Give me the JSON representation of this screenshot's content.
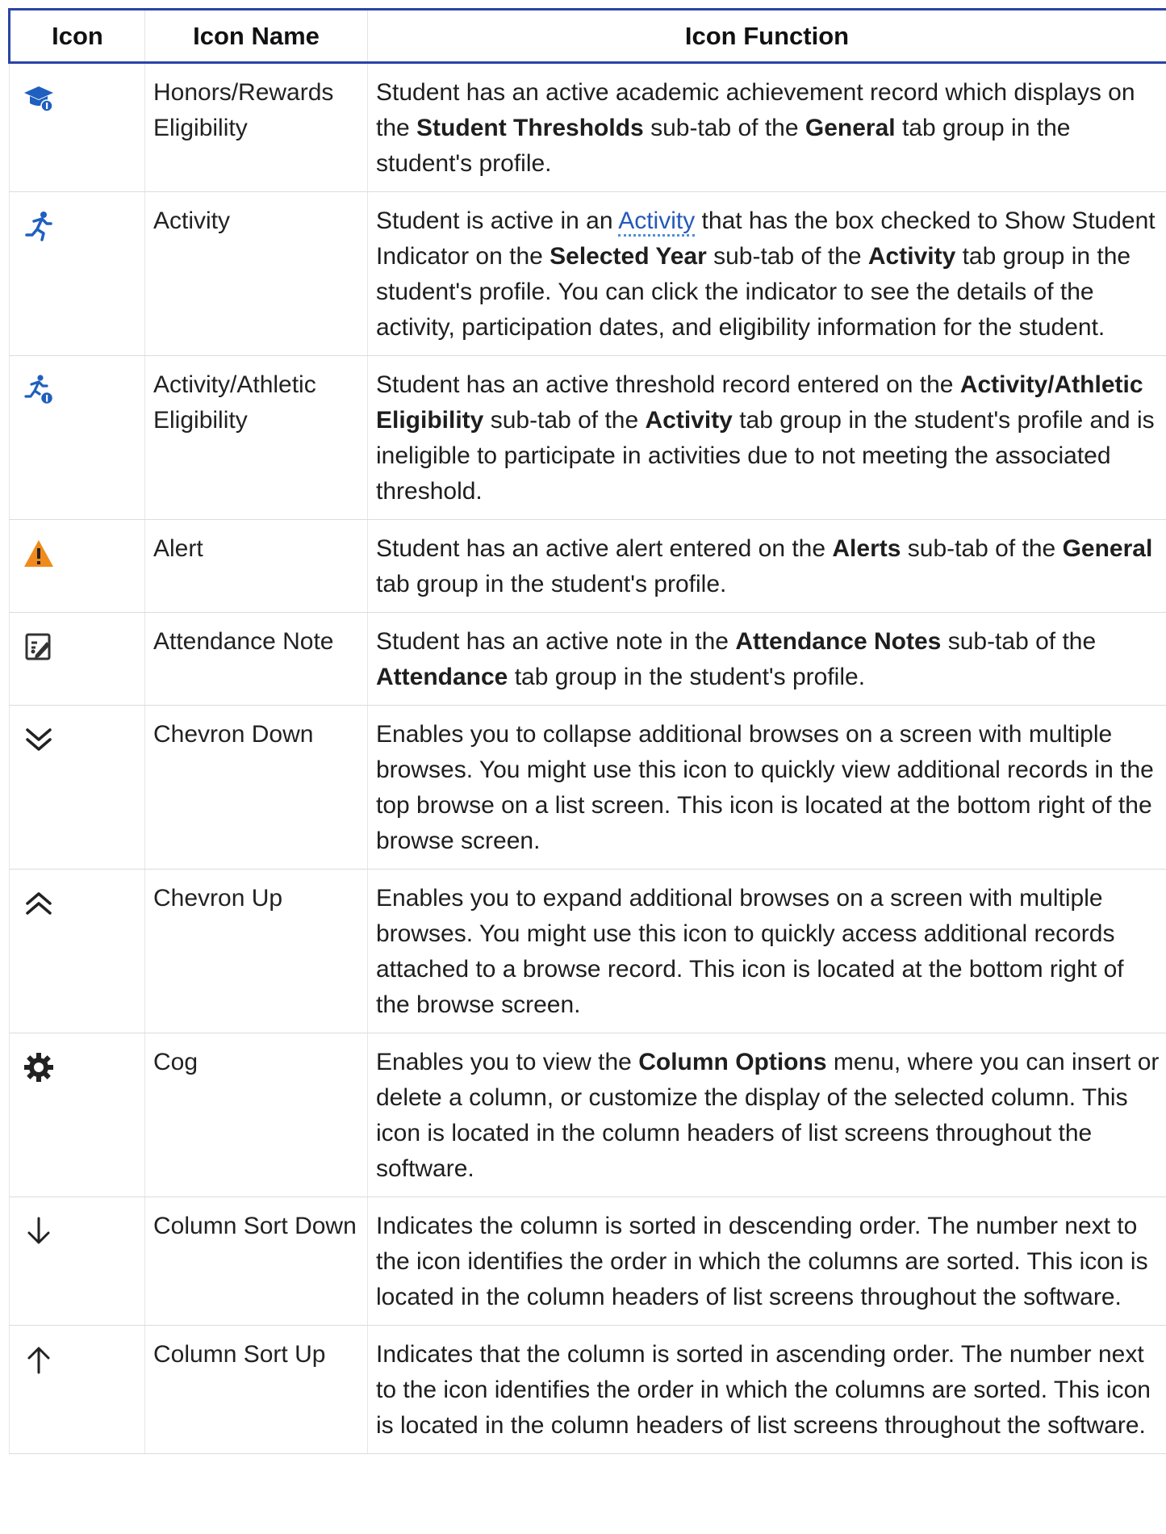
{
  "table": {
    "headers": {
      "icon": "Icon",
      "name": "Icon Name",
      "function": "Icon Function"
    },
    "rows": [
      {
        "icon": "graduation-cap-icon",
        "name": "Honors/Rewards Eligibility",
        "function": [
          {
            "t": "Student has an active academic achievement record which displays on the "
          },
          {
            "t": "Student Thresholds",
            "b": true
          },
          {
            "t": " sub-tab of the "
          },
          {
            "t": "General",
            "b": true
          },
          {
            "t": " tab group in the student's profile."
          }
        ]
      },
      {
        "icon": "running-person-icon",
        "name": "Activity",
        "function": [
          {
            "t": "Student is active in an "
          },
          {
            "t": "Activity",
            "link": true
          },
          {
            "t": " that has the box checked to Show Student Indicator on the "
          },
          {
            "t": "Selected Year",
            "b": true
          },
          {
            "t": " sub-tab of the "
          },
          {
            "t": "Activity",
            "b": true
          },
          {
            "t": " tab group in the student's profile. You can click the indicator to see the details of the activity, participation dates, and eligibility information for the student."
          }
        ]
      },
      {
        "icon": "running-person-badge-icon",
        "name": "Activity/Athletic Eligibility",
        "function": [
          {
            "t": "Student has an active threshold record entered on the "
          },
          {
            "t": "Activity/Athletic Eligibility",
            "b": true
          },
          {
            "t": " sub-tab of the "
          },
          {
            "t": "Activity",
            "b": true
          },
          {
            "t": " tab group in the student's profile and is ineligible to participate in activities due to not meeting the associated threshold."
          }
        ]
      },
      {
        "icon": "alert-triangle-icon",
        "name": "Alert",
        "function": [
          {
            "t": "Student has an active alert entered on the "
          },
          {
            "t": "Alerts",
            "b": true
          },
          {
            "t": " sub-tab of the "
          },
          {
            "t": "General",
            "b": true
          },
          {
            "t": " tab group in the student's profile."
          }
        ]
      },
      {
        "icon": "attendance-note-icon",
        "name": "Attendance Note",
        "function": [
          {
            "t": "Student has an active note in the "
          },
          {
            "t": "Attendance Notes",
            "b": true
          },
          {
            "t": " sub-tab of the "
          },
          {
            "t": "Attendance",
            "b": true
          },
          {
            "t": " tab group in the student's profile."
          }
        ]
      },
      {
        "icon": "chevron-double-down-icon",
        "name": "Chevron Down",
        "function": [
          {
            "t": "Enables you to collapse additional browses on a screen with multiple browses. You might use this icon to quickly view additional records in the top browse on a list screen. This icon is located at the bottom right of the browse screen."
          }
        ]
      },
      {
        "icon": "chevron-double-up-icon",
        "name": "Chevron Up",
        "function": [
          {
            "t": "Enables you to expand additional browses on a screen with multiple browses. You might use this icon to quickly access additional records attached to a browse record. This icon is located at the bottom right of the browse screen."
          }
        ]
      },
      {
        "icon": "cog-icon",
        "name": "Cog",
        "function": [
          {
            "t": "Enables you to view the "
          },
          {
            "t": "Column Options",
            "b": true
          },
          {
            "t": " menu, where you can insert or delete a column, or customize the display of the selected column. This icon is located in the column headers of list screens throughout the software."
          }
        ]
      },
      {
        "icon": "arrow-down-icon",
        "name": "Column Sort Down",
        "function": [
          {
            "t": "Indicates the column is sorted in descending order. The number next to the icon identifies the order in which the columns are sorted. This icon is located in the column headers of list screens throughout the software."
          }
        ]
      },
      {
        "icon": "arrow-up-icon",
        "name": "Column Sort Up",
        "function": [
          {
            "t": "Indicates that the column is sorted in ascending order. The number next to the icon identifies the order in which the columns are sorted. This icon is located in the column headers of list screens throughout the software."
          }
        ]
      }
    ]
  },
  "colors": {
    "header_border": "#2a44a8",
    "icon_blue": "#1f5fbf",
    "alert_orange": "#f08a1c",
    "link_blue": "#2559b8"
  }
}
